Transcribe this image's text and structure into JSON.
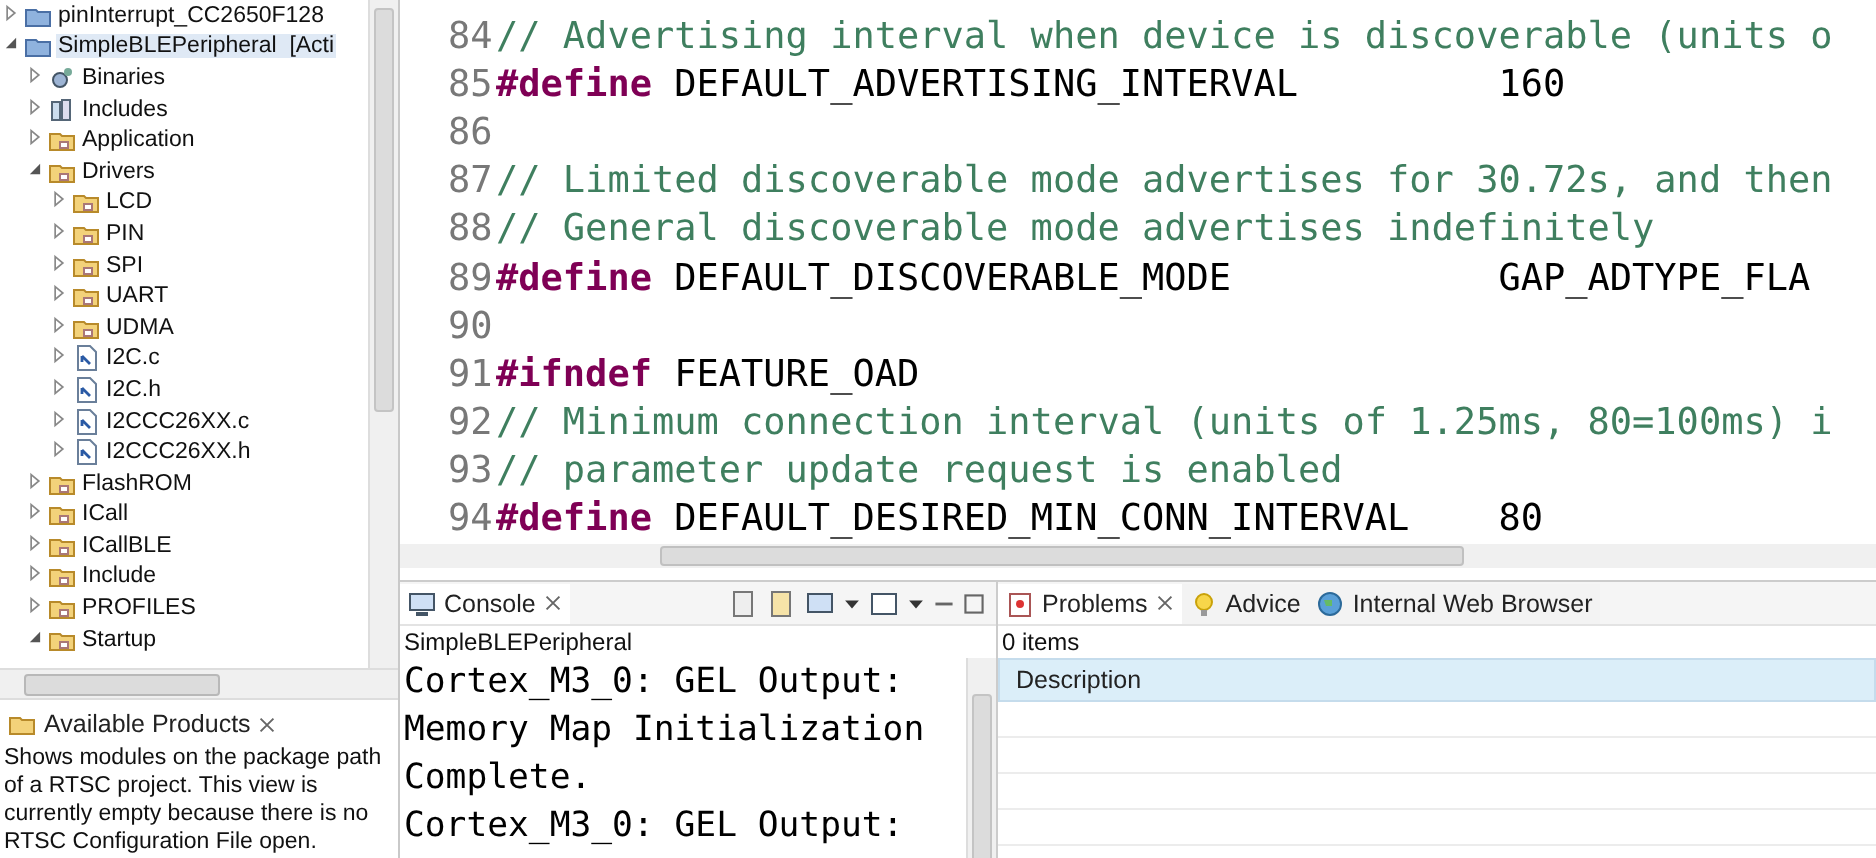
{
  "project_explorer": {
    "items": [
      {
        "label": "pinInterrupt_CC2650F128",
        "kind": "project",
        "expanded": false,
        "selected": false
      },
      {
        "label": "SimpleBLEPeripheral  [Acti",
        "kind": "project",
        "expanded": true,
        "selected": true,
        "children": [
          {
            "label": "Binaries",
            "kind": "binaries",
            "expanded": false,
            "selected": false
          },
          {
            "label": "Includes",
            "kind": "includes",
            "expanded": false,
            "selected": false
          },
          {
            "label": "Application",
            "kind": "folder",
            "expanded": false,
            "selected": false
          },
          {
            "label": "Drivers",
            "kind": "folder",
            "expanded": true,
            "selected": false,
            "children": [
              {
                "label": "LCD",
                "kind": "folder",
                "expanded": false,
                "selected": false
              },
              {
                "label": "PIN",
                "kind": "folder",
                "expanded": false,
                "selected": false
              },
              {
                "label": "SPI",
                "kind": "folder",
                "expanded": false,
                "selected": false
              },
              {
                "label": "UART",
                "kind": "folder",
                "expanded": false,
                "selected": false
              },
              {
                "label": "UDMA",
                "kind": "folder",
                "expanded": false,
                "selected": false
              },
              {
                "label": "I2C.c",
                "kind": "file",
                "expanded": false,
                "selected": false
              },
              {
                "label": "I2C.h",
                "kind": "file",
                "expanded": false,
                "selected": false
              },
              {
                "label": "I2CCC26XX.c",
                "kind": "file",
                "expanded": false,
                "selected": false
              },
              {
                "label": "I2CCC26XX.h",
                "kind": "file",
                "expanded": false,
                "selected": false
              }
            ]
          },
          {
            "label": "FlashROM",
            "kind": "folder",
            "expanded": false,
            "selected": false
          },
          {
            "label": "ICall",
            "kind": "folder",
            "expanded": false,
            "selected": false
          },
          {
            "label": "ICallBLE",
            "kind": "folder",
            "expanded": false,
            "selected": false
          },
          {
            "label": "Include",
            "kind": "folder",
            "expanded": false,
            "selected": false
          },
          {
            "label": "PROFILES",
            "kind": "folder",
            "expanded": false,
            "selected": false
          },
          {
            "label": "Startup",
            "kind": "folder",
            "expanded": true,
            "selected": false
          }
        ]
      }
    ]
  },
  "available_products": {
    "title": "Available Products",
    "message": "Shows modules on the package path of a RTSC project. This view is currently empty because there is no RTSC Configuration File open."
  },
  "editor": {
    "lines": [
      {
        "number": "84",
        "kind": "comment",
        "text": "// Advertising interval when device is discoverable (units o"
      },
      {
        "number": "85",
        "kind": "directive",
        "keyword": "#define",
        "name": "DEFAULT_ADVERTISING_INTERVAL",
        "value": "160"
      },
      {
        "number": "86",
        "kind": "blank"
      },
      {
        "number": "87",
        "kind": "comment",
        "text": "// Limited discoverable mode advertises for 30.72s, and then"
      },
      {
        "number": "88",
        "kind": "comment",
        "text": "// General discoverable mode advertises indefinitely"
      },
      {
        "number": "89",
        "kind": "directive",
        "keyword": "#define",
        "name": "DEFAULT_DISCOVERABLE_MODE",
        "value": "GAP_ADTYPE_FLA"
      },
      {
        "number": "90",
        "kind": "blank"
      },
      {
        "number": "91",
        "kind": "directive",
        "keyword": "#ifndef",
        "name": "FEATURE_OAD"
      },
      {
        "number": "92",
        "kind": "comment",
        "text": "// Minimum connection interval (units of 1.25ms, 80=100ms) i"
      },
      {
        "number": "93",
        "kind": "comment",
        "text": "// parameter update request is enabled"
      },
      {
        "number": "94",
        "kind": "directive",
        "keyword": "#define",
        "name": "DEFAULT_DESIRED_MIN_CONN_INTERVAL",
        "value": "80"
      }
    ]
  },
  "console": {
    "tabs": [
      {
        "label": "Console",
        "selected": true
      }
    ],
    "process": "SimpleBLEPeripheral",
    "lines": [
      "Cortex_M3_0: GEL Output:",
      "Memory Map Initialization",
      "Complete.",
      "Cortex_M3_0: GEL Output:"
    ]
  },
  "problems": {
    "tabs": [
      {
        "label": "Problems",
        "kind": "problems",
        "selected": true
      },
      {
        "label": "Advice",
        "kind": "advice",
        "selected": false
      },
      {
        "label": "Internal Web Browser",
        "kind": "browser",
        "selected": false
      }
    ],
    "count": "0 items",
    "columns": [
      "Description"
    ]
  }
}
